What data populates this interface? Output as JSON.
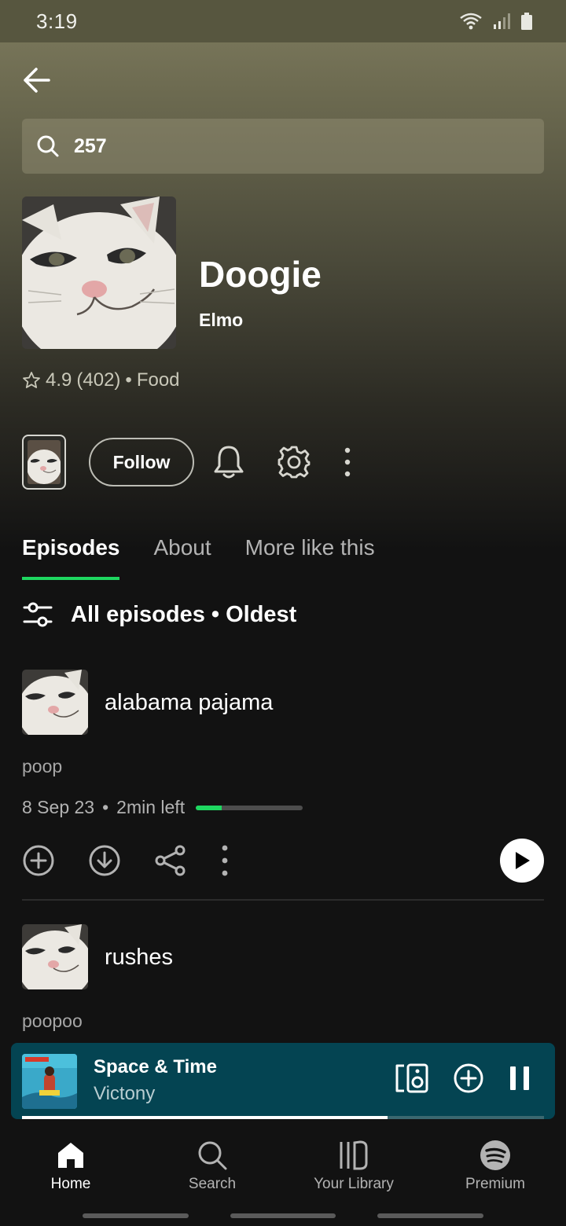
{
  "status_bar": {
    "time": "3:19"
  },
  "search": {
    "query": "257"
  },
  "show": {
    "title": "Doogie",
    "author": "Elmo",
    "rating": "4.9",
    "rating_count": "(402)",
    "separator": "•",
    "category": "Food",
    "follow_label": "Follow"
  },
  "tabs": [
    {
      "label": "Episodes",
      "active": true
    },
    {
      "label": "About",
      "active": false
    },
    {
      "label": "More like this",
      "active": false
    }
  ],
  "filter": {
    "label": "All episodes • Oldest"
  },
  "episodes": [
    {
      "title": "alabama pajama",
      "description": "poop",
      "date": "8 Sep 23",
      "separator": "•",
      "time_left": "2min left",
      "progress": 0.24
    },
    {
      "title": "rushes",
      "description": "poopoo"
    }
  ],
  "now_playing": {
    "title": "Space & Time",
    "artist": "Victony",
    "progress": 0.7,
    "bg_color": "#044452"
  },
  "nav": [
    {
      "label": "Home",
      "icon": "home-icon",
      "active": true
    },
    {
      "label": "Search",
      "icon": "search-icon",
      "active": false
    },
    {
      "label": "Your Library",
      "icon": "library-icon",
      "active": false
    },
    {
      "label": "Premium",
      "icon": "spotify-icon",
      "active": false
    }
  ],
  "colors": {
    "accent": "#1ed760",
    "background": "#121212"
  }
}
